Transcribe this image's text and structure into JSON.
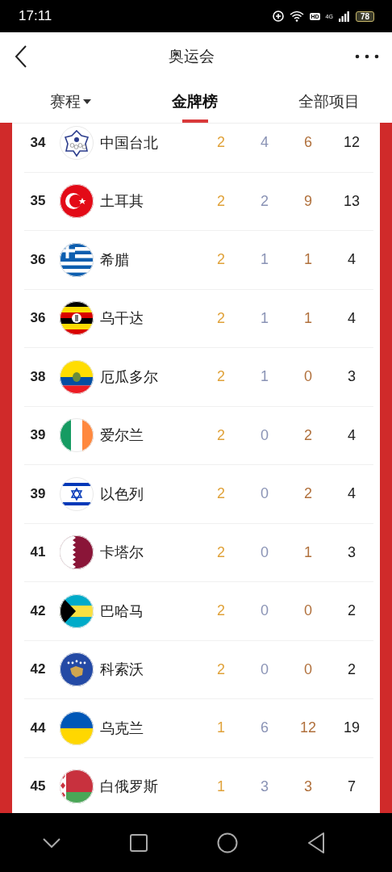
{
  "status_bar": {
    "time": "17:11",
    "hd": "HD",
    "network": "4G",
    "battery": "78"
  },
  "header": {
    "title": "奥运会"
  },
  "tabs": [
    {
      "label": "赛程",
      "selected": false,
      "dropdown": true
    },
    {
      "label": "金牌榜",
      "selected": true,
      "dropdown": false
    },
    {
      "label": "全部项目",
      "selected": false,
      "dropdown": false
    }
  ],
  "medal_table": {
    "rows": [
      {
        "rank": "34",
        "country": "中国台北",
        "gold": "2",
        "silver": "4",
        "bronze": "6",
        "total": "12"
      },
      {
        "rank": "35",
        "country": "土耳其",
        "gold": "2",
        "silver": "2",
        "bronze": "9",
        "total": "13"
      },
      {
        "rank": "36",
        "country": "希腊",
        "gold": "2",
        "silver": "1",
        "bronze": "1",
        "total": "4"
      },
      {
        "rank": "36",
        "country": "乌干达",
        "gold": "2",
        "silver": "1",
        "bronze": "1",
        "total": "4"
      },
      {
        "rank": "38",
        "country": "厄瓜多尔",
        "gold": "2",
        "silver": "1",
        "bronze": "0",
        "total": "3"
      },
      {
        "rank": "39",
        "country": "爱尔兰",
        "gold": "2",
        "silver": "0",
        "bronze": "2",
        "total": "4"
      },
      {
        "rank": "39",
        "country": "以色列",
        "gold": "2",
        "silver": "0",
        "bronze": "2",
        "total": "4"
      },
      {
        "rank": "41",
        "country": "卡塔尔",
        "gold": "2",
        "silver": "0",
        "bronze": "1",
        "total": "3"
      },
      {
        "rank": "42",
        "country": "巴哈马",
        "gold": "2",
        "silver": "0",
        "bronze": "0",
        "total": "2"
      },
      {
        "rank": "42",
        "country": "科索沃",
        "gold": "2",
        "silver": "0",
        "bronze": "0",
        "total": "2"
      },
      {
        "rank": "44",
        "country": "乌克兰",
        "gold": "1",
        "silver": "6",
        "bronze": "12",
        "total": "19"
      },
      {
        "rank": "45",
        "country": "白俄罗斯",
        "gold": "1",
        "silver": "3",
        "bronze": "3",
        "total": "7"
      }
    ]
  }
}
